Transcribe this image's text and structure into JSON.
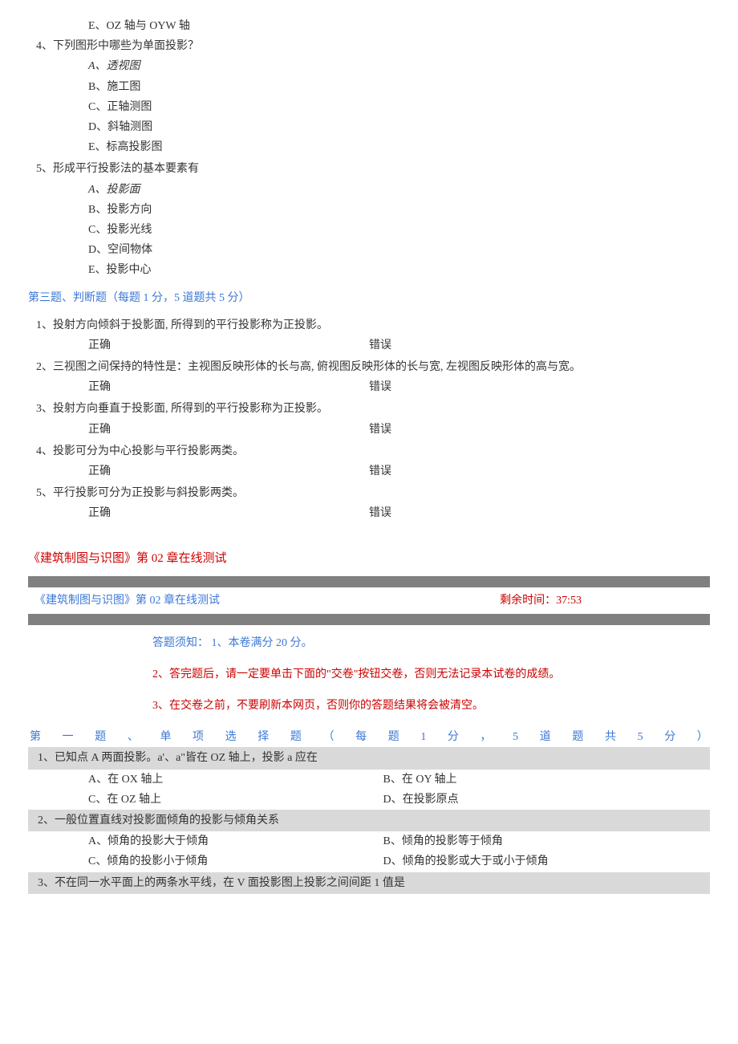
{
  "q_opts_prev": {
    "e": "E、OZ 轴与 OYW 轴"
  },
  "q4": {
    "text": "4、下列图形中哪些为单面投影？",
    "a": "A、透视图",
    "b": "B、施工图",
    "c": "C、正轴测图",
    "d": "D、斜轴测图",
    "e": "E、标高投影图"
  },
  "q5": {
    "text": "5、形成平行投影法的基本要素有",
    "a": "A、投影面",
    "b": "B、投影方向",
    "c": "C、投影光线",
    "d": "D、空间物体",
    "e": "E、投影中心"
  },
  "sec3": {
    "header": "第三题、判断题（每题 1 分，5 道题共 5 分）",
    "true_label": "正确",
    "false_label": "错误",
    "q1": "1、投射方向倾斜于投影面, 所得到的平行投影称为正投影。",
    "q2": "2、三视图之间保持的特性是：主视图反映形体的长与高, 俯视图反映形体的长与宽, 左视图反映形体的高与宽。",
    "q3": "3、投射方向垂直于投影面, 所得到的平行投影称为正投影。",
    "q4": "4、投影可分为中心投影与平行投影两类。",
    "q5": "5、平行投影可分为正投影与斜投影两类。"
  },
  "ch2": {
    "title": "《建筑制图与识图》第 02 章在线测试",
    "header_left": "《建筑制图与识图》第 02 章在线测试",
    "timer_label": "剩余时间：",
    "timer_value": "37:53",
    "inst_prefix": "答题须知：",
    "inst1": "1、本卷满分 20 分。",
    "inst2": "2、答完题后，请一定要单击下面的\"交卷\"按钮交卷，否则无法记录本试卷的成绩。",
    "inst3": "3、在交卷之前，不要刷新本网页，否则你的答题结果将会被清空。",
    "sec1_header": "第一题、单项选择题（每题1分，5道题共5分）",
    "q1": {
      "text": "1、已知点 A 两面投影。a'、a\"皆在 OZ 轴上，投影 a 应在",
      "a": "A、在 OX 轴上",
      "b": "B、在 OY 轴上",
      "c": "C、在 OZ 轴上",
      "d": "D、在投影原点"
    },
    "q2": {
      "text": "2、一般位置直线对投影面倾角的投影与倾角关系",
      "a": "A、倾角的投影大于倾角",
      "b": "B、倾角的投影等于倾角",
      "c": "C、倾角的投影小于倾角",
      "d": "D、倾角的投影或大于或小于倾角"
    },
    "q3": {
      "text": "3、不在同一水平面上的两条水平线，在 V 面投影图上投影之间间距 1 值是"
    }
  }
}
